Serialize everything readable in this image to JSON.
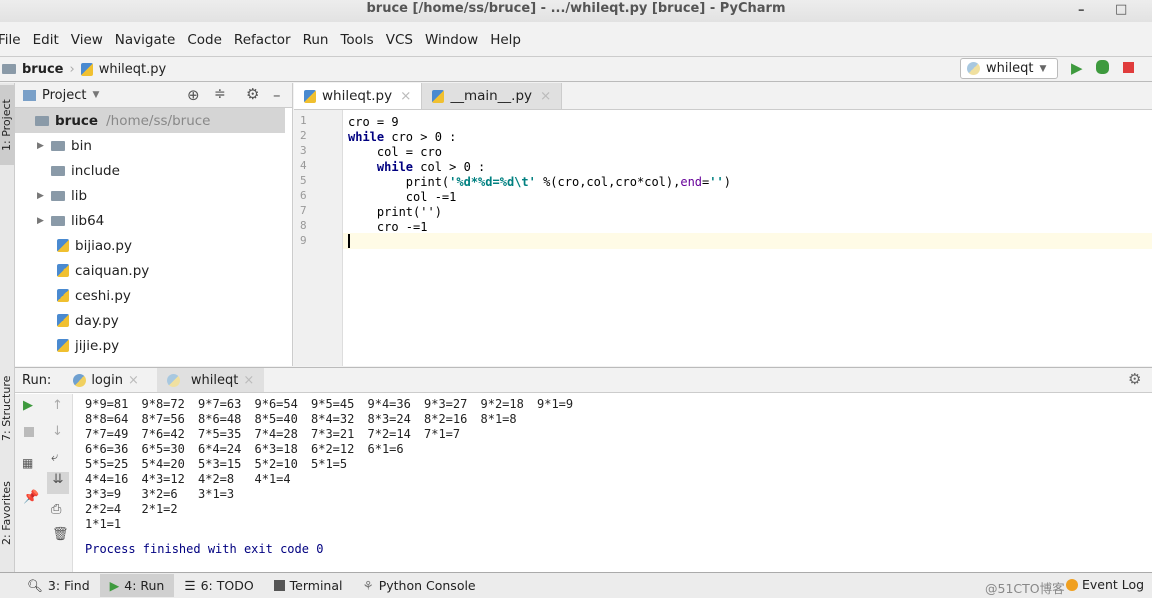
{
  "window": {
    "title": "bruce [/home/ss/bruce] - .../whileqt.py [bruce] - PyCharm",
    "minimize": "–",
    "maximize": "□"
  },
  "menu": [
    "File",
    "Edit",
    "View",
    "Navigate",
    "Code",
    "Refactor",
    "Run",
    "Tools",
    "VCS",
    "Window",
    "Help"
  ],
  "breadcrumb": {
    "project": "bruce",
    "file": "whileqt.py"
  },
  "run_config": {
    "selected": "whileqt"
  },
  "colors": {
    "run": "#3e9a3e",
    "stop": "#e03c3c",
    "selection": "#d5d5d5"
  },
  "side_tabs": {
    "project": "1: Project",
    "structure": "7: Structure",
    "favorites": "2: Favorites"
  },
  "project": {
    "header": "Project",
    "root": {
      "name": "bruce",
      "path": "/home/ss/bruce"
    },
    "items": [
      {
        "name": "bin",
        "type": "folder",
        "expandable": true
      },
      {
        "name": "include",
        "type": "folder",
        "expandable": false
      },
      {
        "name": "lib",
        "type": "folder",
        "expandable": true
      },
      {
        "name": "lib64",
        "type": "folder",
        "expandable": true
      },
      {
        "name": "bijiao.py",
        "type": "py"
      },
      {
        "name": "caiquan.py",
        "type": "py"
      },
      {
        "name": "ceshi.py",
        "type": "py"
      },
      {
        "name": "day.py",
        "type": "py"
      },
      {
        "name": "jijie.py",
        "type": "py"
      }
    ]
  },
  "editor": {
    "tabs": [
      {
        "label": "whileqt.py",
        "active": true
      },
      {
        "label": "__main__.py",
        "active": false
      }
    ],
    "lines": [
      "cro = 9",
      "while cro > 0 :",
      "    col = cro",
      "    while col > 0 :",
      "        print('%d*%d=%d\\t' %(cro,col,cro*col),end='')",
      "        col -=1",
      "    print('')",
      "    cro -=1",
      ""
    ]
  },
  "run": {
    "label": "Run:",
    "tabs": [
      "login",
      "whileqt"
    ],
    "output": [
      [
        "9*9=81",
        "9*8=72",
        "9*7=63",
        "9*6=54",
        "9*5=45",
        "9*4=36",
        "9*3=27",
        "9*2=18",
        "9*1=9"
      ],
      [
        "8*8=64",
        "8*7=56",
        "8*6=48",
        "8*5=40",
        "8*4=32",
        "8*3=24",
        "8*2=16",
        "8*1=8"
      ],
      [
        "7*7=49",
        "7*6=42",
        "7*5=35",
        "7*4=28",
        "7*3=21",
        "7*2=14",
        "7*1=7"
      ],
      [
        "6*6=36",
        "6*5=30",
        "6*4=24",
        "6*3=18",
        "6*2=12",
        "6*1=6"
      ],
      [
        "5*5=25",
        "5*4=20",
        "5*3=15",
        "5*2=10",
        "5*1=5"
      ],
      [
        "4*4=16",
        "4*3=12",
        "4*2=8",
        "4*1=4"
      ],
      [
        "3*3=9",
        "3*2=6",
        "3*1=3"
      ],
      [
        "2*2=4",
        "2*1=2"
      ],
      [
        "1*1=1"
      ]
    ],
    "exit_message": "Process finished with exit code 0"
  },
  "statusbar": {
    "tabs": [
      "3: Find",
      "4: Run",
      "6: TODO",
      "Terminal",
      "Python Console"
    ],
    "event_log": "Event Log",
    "watermark": "@51CTO博客"
  }
}
